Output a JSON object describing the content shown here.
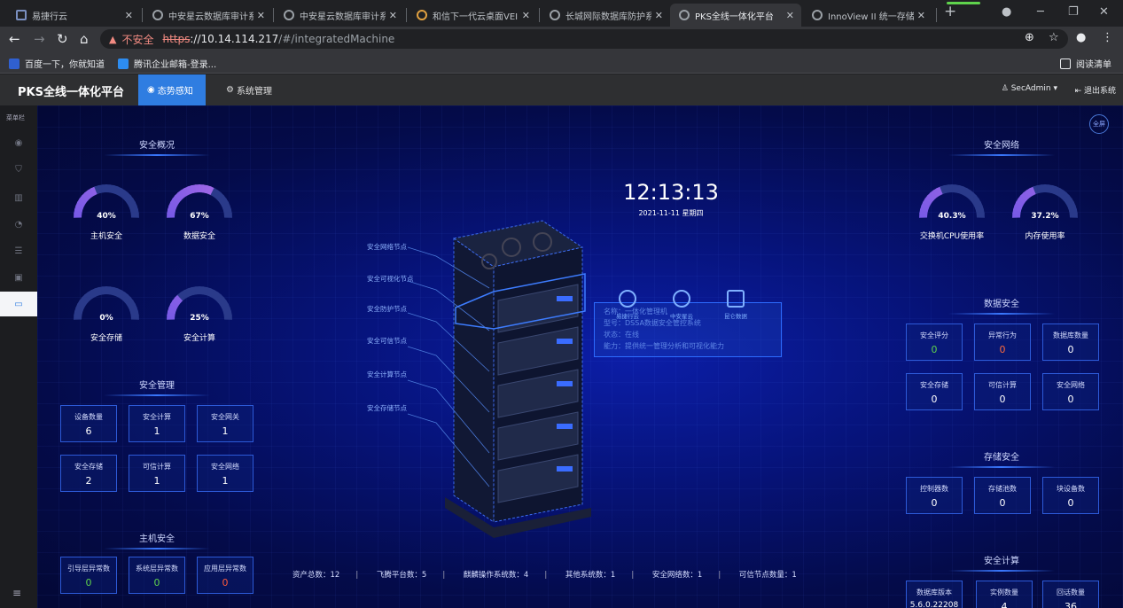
{
  "browser": {
    "tabs": [
      {
        "label": "易捷行云",
        "active": false
      },
      {
        "label": "中安星云数据库审计系",
        "active": false
      },
      {
        "label": "中安星云数据库审计系",
        "active": false
      },
      {
        "label": "和信下一代云桌面VEI",
        "active": false
      },
      {
        "label": "长城网际数据库防护系",
        "active": false
      },
      {
        "label": "PKS全线一体化平台",
        "active": true
      },
      {
        "label": "InnoView II 统一存储",
        "active": false
      }
    ],
    "close_glyph": "✕",
    "new_tab_glyph": "+",
    "url": {
      "insecure_label": "不安全",
      "scheme": "https",
      "host": "://10.14.114.217",
      "path": "/#/integratedMachine"
    },
    "bookmarks": [
      {
        "label": "百度一下，你就知道",
        "color": "#3060d0"
      },
      {
        "label": "腾讯企业邮箱-登录...",
        "color": "#2d8cf0"
      }
    ],
    "reading_list": "阅读清单"
  },
  "app": {
    "brand": "PKS全线一体化平台",
    "nav": [
      {
        "label": "态势感知",
        "active": true
      },
      {
        "label": "系统管理",
        "active": false
      }
    ],
    "user": "SecAdmin",
    "logout": "退出系统",
    "sidebar_title": "菜单栏",
    "fullscreen": "全屏"
  },
  "dashboard": {
    "clock": "12:13:13",
    "date": "2021-11-11 星期四",
    "overview_title": "安全概况",
    "overview_gauges": [
      {
        "label": "主机安全",
        "value": "40%",
        "ratio": 0.4
      },
      {
        "label": "数据安全",
        "value": "67%",
        "ratio": 0.67
      },
      {
        "label": "安全存储",
        "value": "0%",
        "ratio": 0.0
      },
      {
        "label": "安全计算",
        "value": "25%",
        "ratio": 0.25
      }
    ],
    "management_title": "安全管理",
    "management": [
      {
        "label": "设备数量",
        "value": "6"
      },
      {
        "label": "安全计算",
        "value": "1"
      },
      {
        "label": "安全网关",
        "value": "1"
      },
      {
        "label": "安全存储",
        "value": "2"
      },
      {
        "label": "可信计算",
        "value": "1"
      },
      {
        "label": "安全网络",
        "value": "1"
      }
    ],
    "host_title": "主机安全",
    "host": [
      {
        "label": "引导层异常数",
        "value": "0",
        "color": "#5fd34c"
      },
      {
        "label": "系统层异常数",
        "value": "0",
        "color": "#5fd34c"
      },
      {
        "label": "应用层异常数",
        "value": "0",
        "color": "#ff5a3c"
      }
    ],
    "network_title": "安全网络",
    "network_gauges": [
      {
        "label": "交换机CPU使用率",
        "value": "40.3%",
        "ratio": 0.403
      },
      {
        "label": "内存使用率",
        "value": "37.2%",
        "ratio": 0.372
      }
    ],
    "data_title": "数据安全",
    "data": [
      {
        "label": "安全评分",
        "value": "0",
        "color": "#5fd34c"
      },
      {
        "label": "异常行为",
        "value": "0",
        "color": "#ff6a3c"
      },
      {
        "label": "数据库数量",
        "value": "0",
        "color": "#ffffff"
      },
      {
        "label": "安全存储",
        "value": "0",
        "color": "#ffffff"
      },
      {
        "label": "可信计算",
        "value": "0",
        "color": "#ffffff"
      },
      {
        "label": "安全网络",
        "value": "0",
        "color": "#ffffff"
      }
    ],
    "storage_title": "存储安全",
    "storage": [
      {
        "label": "控制器数",
        "value": "0"
      },
      {
        "label": "存储池数",
        "value": "0"
      },
      {
        "label": "块设备数",
        "value": "0"
      }
    ],
    "compute_title": "安全计算",
    "compute": [
      {
        "label": "数据库版本",
        "value": "5.6.0.22208"
      },
      {
        "label": "实例数量",
        "value": "4"
      },
      {
        "label": "回话数量",
        "value": "36"
      }
    ],
    "nodes": [
      "安全网络节点",
      "安全可视化节点",
      "安全防护节点",
      "安全可信节点",
      "安全计算节点",
      "安全存储节点"
    ],
    "apps": [
      "易捷行云",
      "中安星云",
      "昆仑数据"
    ],
    "info": {
      "line1": "名称：一体化管理机",
      "line2": "型号：DSSA数据安全管控系统",
      "line3": "状态：在线",
      "line4": "能力：提供统一管理分析和可视化能力"
    },
    "stats": [
      "资产总数：12",
      "飞腾平台数：5",
      "麒麟操作系统数：4",
      "其他系统数：1",
      "安全网络数：1",
      "可信节点数量：1"
    ],
    "stat_sep": "|"
  }
}
